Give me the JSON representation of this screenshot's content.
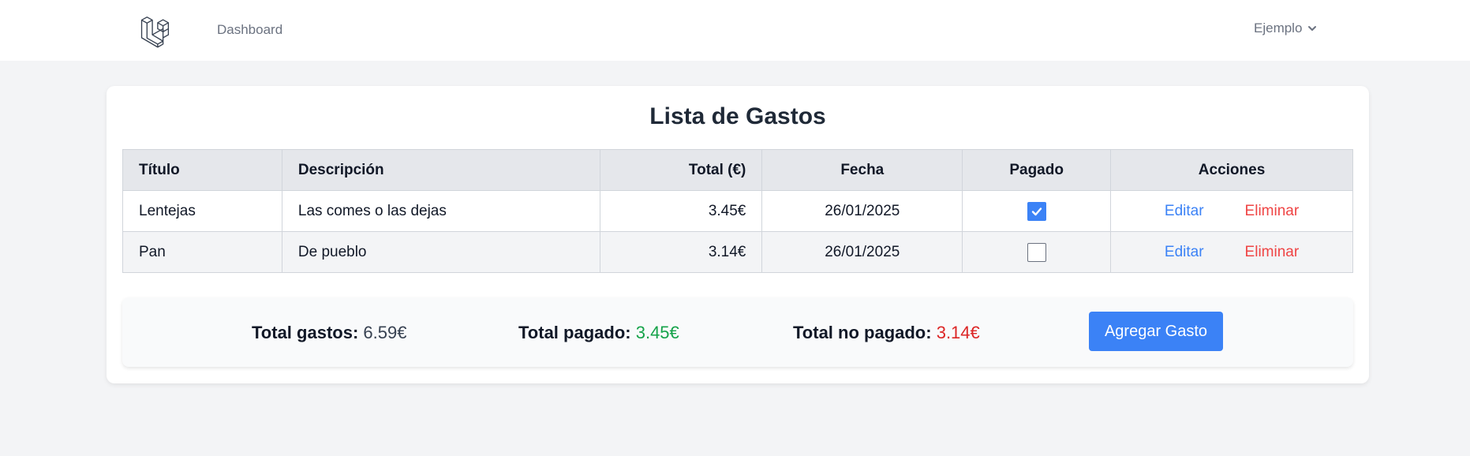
{
  "nav": {
    "logo_icon": "laravel-logo-icon",
    "dashboard_label": "Dashboard",
    "user_label": "Ejemplo",
    "user_chevron_icon": "chevron-down-icon"
  },
  "page": {
    "title": "Lista de Gastos"
  },
  "table": {
    "headers": {
      "titulo": "Título",
      "descripcion": "Descripción",
      "total": "Total (€)",
      "fecha": "Fecha",
      "pagado": "Pagado",
      "acciones": "Acciones"
    },
    "rows": [
      {
        "titulo": "Lentejas",
        "descripcion": "Las comes o las dejas",
        "total": "3.45€",
        "fecha": "26/01/2025",
        "pagado": true,
        "edit_label": "Editar",
        "delete_label": "Eliminar"
      },
      {
        "titulo": "Pan",
        "descripcion": "De pueblo",
        "total": "3.14€",
        "fecha": "26/01/2025",
        "pagado": false,
        "edit_label": "Editar",
        "delete_label": "Eliminar"
      }
    ]
  },
  "summary": {
    "total_gastos_label": "Total gastos:",
    "total_gastos_value": "6.59€",
    "total_pagado_label": "Total pagado:",
    "total_pagado_value": "3.45€",
    "total_no_pagado_label": "Total no pagado:",
    "total_no_pagado_value": "3.14€",
    "add_button_label": "Agregar Gasto"
  },
  "colors": {
    "accent_blue": "#3b82f6",
    "delete_red": "#ef4444",
    "paid_green": "#16a34a",
    "unpaid_red": "#dc2626"
  }
}
